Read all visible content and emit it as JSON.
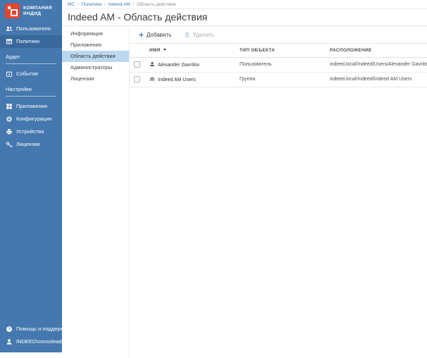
{
  "brand": {
    "line1": "КОМПАНИЯ",
    "line2": "ИНДИД"
  },
  "sidebar": {
    "items": [
      {
        "label": "Пользователи",
        "icon": "users"
      },
      {
        "label": "Политики",
        "icon": "policies",
        "active": true
      },
      {
        "label": "Аудит",
        "type": "section"
      },
      {
        "label": "События",
        "icon": "events"
      },
      {
        "label": "Настройки",
        "type": "section"
      },
      {
        "label": "Приложения",
        "icon": "apps"
      },
      {
        "label": "Конфигурация",
        "icon": "gear"
      },
      {
        "label": "Устройства",
        "icon": "devices"
      },
      {
        "label": "Лицензии",
        "icon": "key"
      }
    ],
    "footer": [
      {
        "label": "Помощь и поддержка",
        "icon": "help"
      },
      {
        "label": "INDEED\\consoleadmin",
        "icon": "user",
        "has_caret": true
      }
    ]
  },
  "breadcrumb": {
    "links": [
      "MC",
      "Политики",
      "Indeed AM"
    ],
    "current": "Область действия",
    "separator": "/"
  },
  "page_title": "Indeed AM - Область действия",
  "tabs": [
    "Информация",
    "Приложения",
    "Область действия",
    "Администраторы",
    "Лицензии"
  ],
  "active_tab": "Область действия",
  "toolbar": {
    "add_label": "Добавить",
    "delete_label": "Удалить",
    "delete_enabled": false
  },
  "table": {
    "columns": [
      "ИМЯ",
      "ТИП ОБЪЕКТА",
      "РАСПОЛОЖЕНИЕ"
    ],
    "sorted_by": "ИМЯ",
    "rows": [
      {
        "name": "Alexander Gavrilov",
        "icon": "user",
        "type": "Пользователь",
        "location": "indeed.local/Indeed/Users/Alexander Gavrilov",
        "checked": false
      },
      {
        "name": "Indeed AM Users",
        "icon": "group",
        "type": "Группа",
        "location": "indeed.local/Indeed/Indeed AM Users",
        "checked": false
      }
    ]
  },
  "colors": {
    "sidebar_bg": "#4478ae",
    "sidebar_active_bg": "#39689c",
    "logo_red": "#e8432d",
    "link_blue": "#3779b5",
    "tab_active_bg": "#bcd8ef",
    "accent_blue": "#3a7bbf",
    "disabled_gray": "#ababab"
  }
}
